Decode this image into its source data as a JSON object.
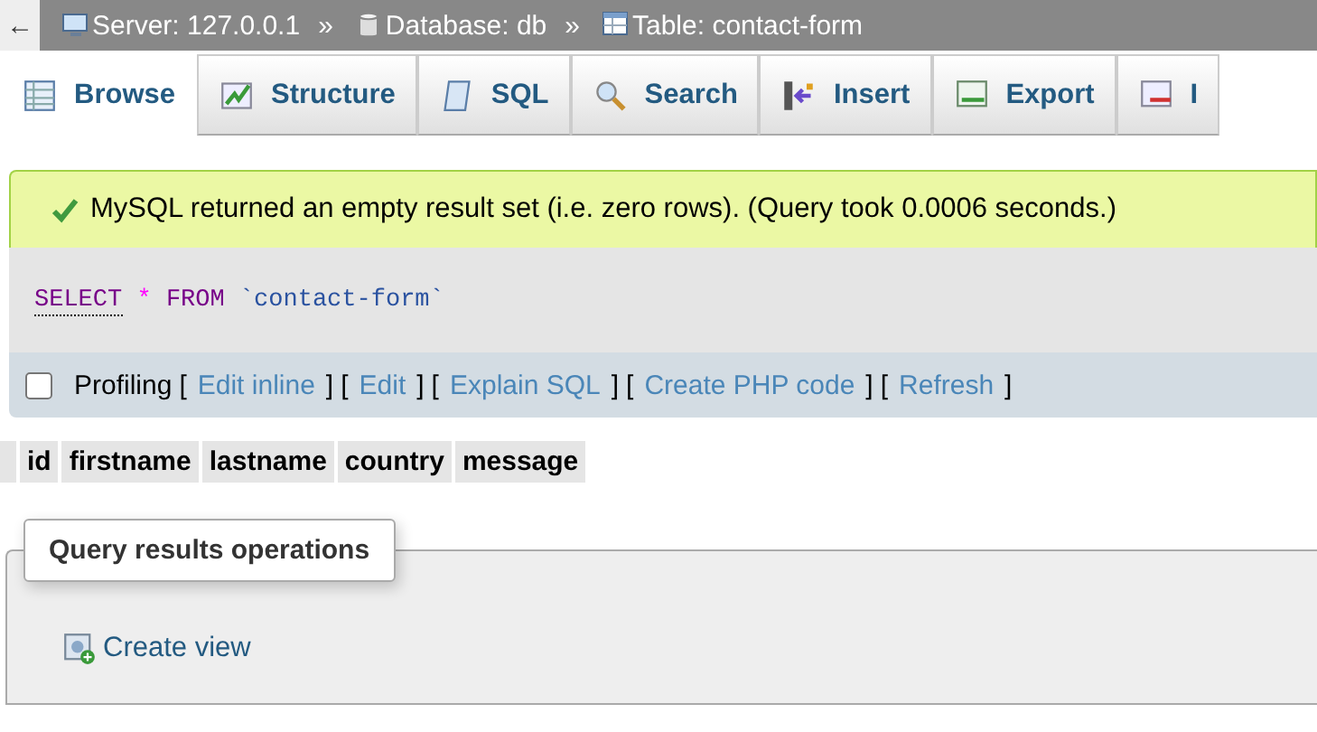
{
  "breadcrumb": [
    {
      "kind": "server",
      "label": "Server: 127.0.0.1"
    },
    {
      "kind": "database",
      "label": "Database: db"
    },
    {
      "kind": "table",
      "label": "Table: contact-form"
    }
  ],
  "breadcrumb_separator": "»",
  "back_arrow": "←",
  "tabs": [
    {
      "kind": "browse",
      "label": "Browse",
      "selected": true
    },
    {
      "kind": "structure",
      "label": "Structure",
      "selected": false
    },
    {
      "kind": "sql",
      "label": "SQL",
      "selected": false
    },
    {
      "kind": "search",
      "label": "Search",
      "selected": false
    },
    {
      "kind": "insert",
      "label": "Insert",
      "selected": false
    },
    {
      "kind": "export",
      "label": "Export",
      "selected": false
    },
    {
      "kind": "import",
      "label": "I",
      "selected": false
    }
  ],
  "success_message": "MySQL returned an empty result set (i.e. zero rows). (Query took 0.0006 seconds.)",
  "query": {
    "keyword": "SELECT",
    "star": "*",
    "from": "FROM",
    "table": "`contact-form`"
  },
  "profiling": {
    "checked": false,
    "label": "Profiling",
    "bracket_open": "[",
    "bracket_close": "]",
    "links": [
      "Edit inline",
      "Edit",
      "Explain SQL",
      "Create PHP code",
      "Refresh"
    ]
  },
  "columns": [
    "id",
    "firstname",
    "lastname",
    "country",
    "message"
  ],
  "operations": {
    "legend": "Query results operations",
    "links": [
      "Create view"
    ]
  }
}
